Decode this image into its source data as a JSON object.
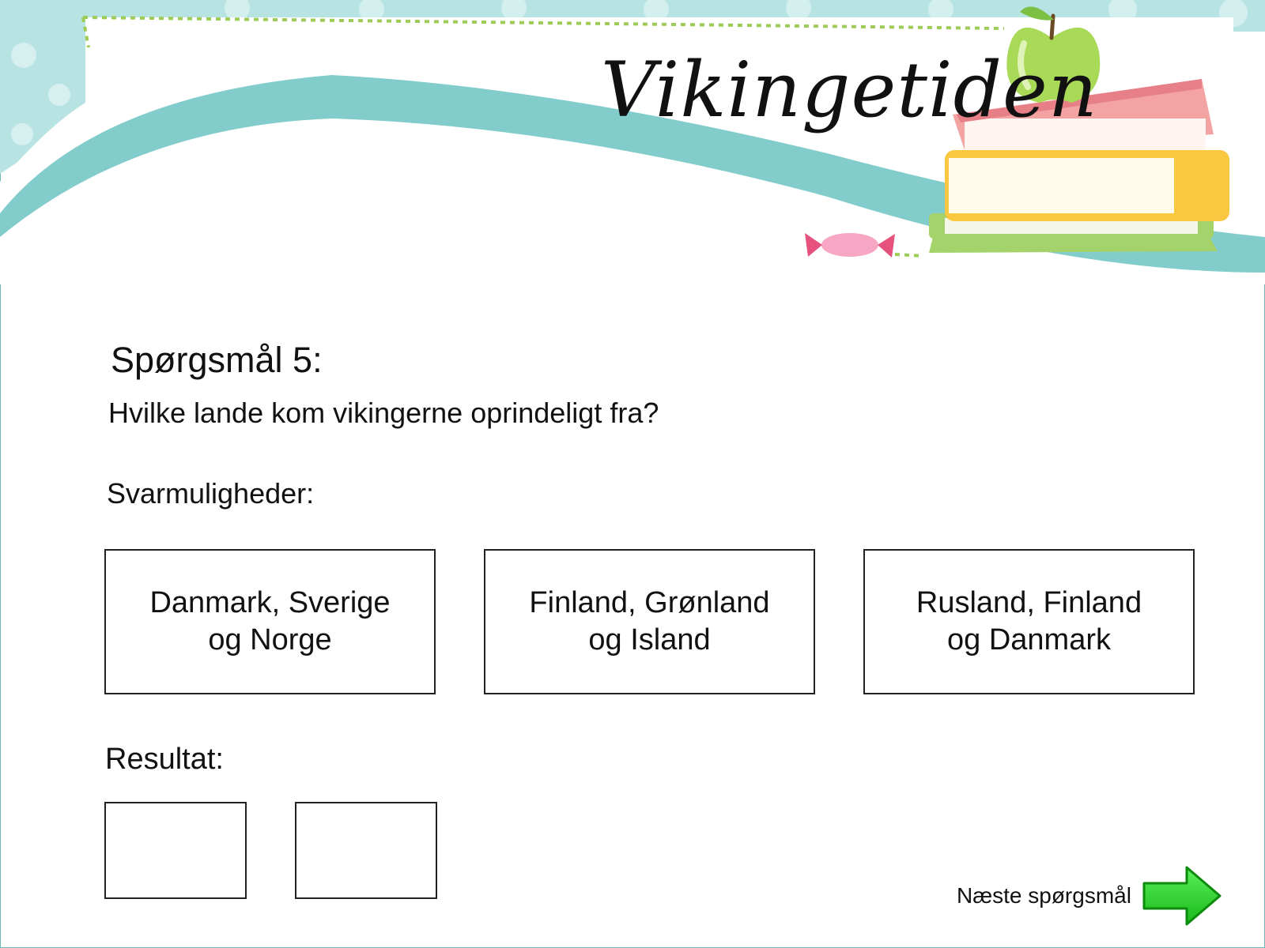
{
  "header": {
    "title": "Vikingetiden"
  },
  "question": {
    "heading": "Spørgsmål 5:",
    "text": "Hvilke lande kom vikingerne oprindeligt fra?"
  },
  "options_label": "Svarmuligheder:",
  "options": [
    {
      "label": "Danmark, Sverige\nog Norge"
    },
    {
      "label": "Finland, Grønland\nog Island"
    },
    {
      "label": "Rusland, Finland\nog Danmark"
    }
  ],
  "result": {
    "label": "Resultat:"
  },
  "next": {
    "label": "Næste spørgsmål"
  },
  "icons": {
    "apple": "apple-icon",
    "books": "books-icon",
    "candy": "candy-icon",
    "next_arrow": "arrow-right-icon"
  },
  "colors": {
    "teal": "#82cccb",
    "teal_light": "#b7e3e2",
    "book_pink": "#f4a3a3",
    "book_yellow": "#f9c840",
    "book_green": "#a5d36b",
    "arrow_green": "#22cc22"
  }
}
